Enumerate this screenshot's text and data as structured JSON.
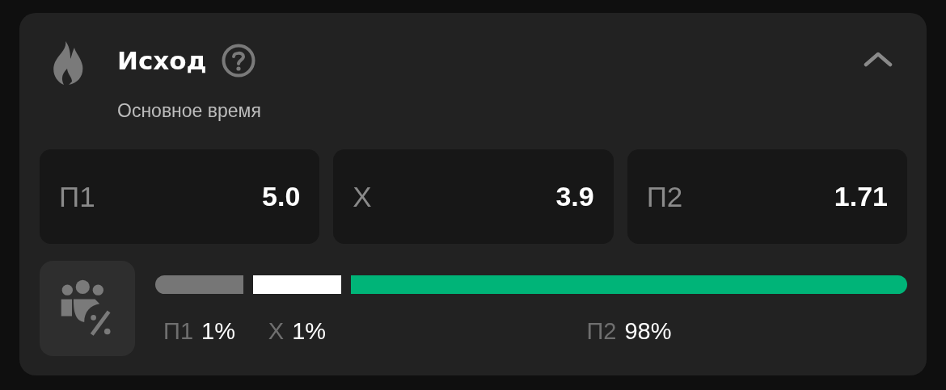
{
  "market": {
    "title": "Исход",
    "subtitle": "Основное время",
    "expanded": true
  },
  "odds": [
    {
      "label": "П1",
      "value": "5.0"
    },
    {
      "label": "Х",
      "value": "3.9"
    },
    {
      "label": "П2",
      "value": "1.71"
    }
  ],
  "distribution": [
    {
      "label": "П1",
      "percent": "1%",
      "color": "#767676"
    },
    {
      "label": "Х",
      "percent": "1%",
      "color": "#ffffff"
    },
    {
      "label": "П2",
      "percent": "98%",
      "color": "#00b478"
    }
  ]
}
